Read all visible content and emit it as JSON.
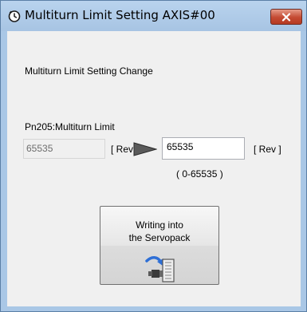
{
  "window": {
    "title": "Multiturn Limit Setting AXIS#00",
    "icons": {
      "title_icon": "clock-icon",
      "close": "close-icon"
    },
    "colors": {
      "frame": "#a9c7e6",
      "close_button": "#c44a32"
    }
  },
  "content": {
    "heading": "Multiturn Limit Setting Change",
    "param_label": "Pn205:Multiturn Limit",
    "current_value": "65535",
    "current_unit": "[ Rev ]",
    "new_value": "65535",
    "new_unit": "[ Rev ]",
    "range": "( 0-65535 )",
    "arrow_icon": "right-arrow-icon"
  },
  "write_button": {
    "line1": "Writing into",
    "line2": "the Servopack",
    "icon": "servopack-write-icon"
  }
}
